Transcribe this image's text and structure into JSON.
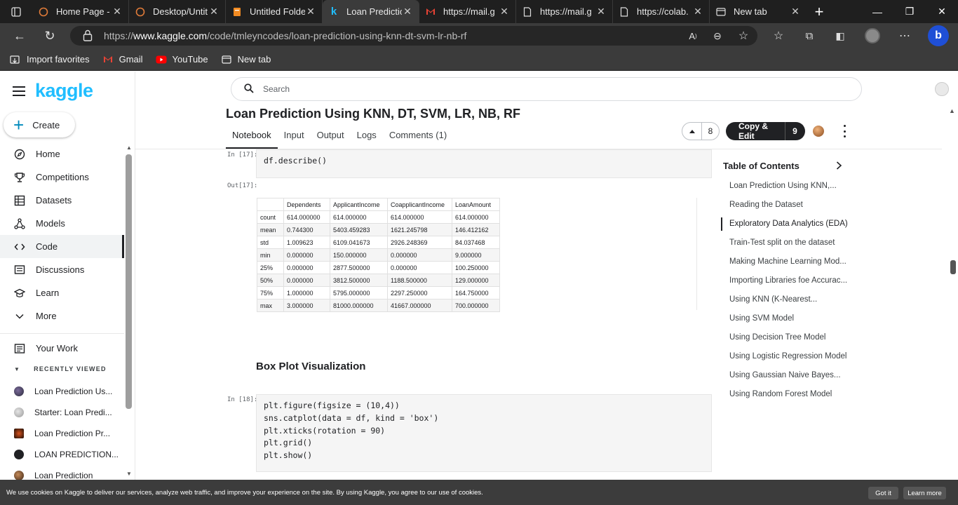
{
  "browser": {
    "tabs": [
      {
        "title": "Home Page -",
        "icon": "generic-orange-ring-icon",
        "active": false
      },
      {
        "title": "Desktop/Untit",
        "icon": "generic-orange-ring-icon",
        "active": false
      },
      {
        "title": "Untitled Folde",
        "icon": "document-orange-icon",
        "active": false
      },
      {
        "title": "Loan Predictio",
        "icon": "kaggle-k-icon",
        "active": true
      },
      {
        "title": "https://mail.g",
        "icon": "gmail-icon",
        "active": false
      },
      {
        "title": "https://mail.g",
        "icon": "page-icon",
        "active": false
      },
      {
        "title": "https://colab.",
        "icon": "page-icon",
        "active": false
      },
      {
        "title": "New tab",
        "icon": "newtab-icon",
        "active": false
      }
    ],
    "address": {
      "prefix": "https://",
      "host": "www.kaggle.com",
      "path": "/code/tmleyncodes/loan-prediction-using-knn-dt-svm-lr-nb-rf"
    },
    "favorites": [
      {
        "label": "Import favorites",
        "icon": "import-icon"
      },
      {
        "label": "Gmail",
        "icon": "gmail-icon"
      },
      {
        "label": "YouTube",
        "icon": "youtube-icon"
      },
      {
        "label": "New tab",
        "icon": "newtab-icon"
      }
    ]
  },
  "sidebar": {
    "logo": "kaggle",
    "create_label": "Create",
    "items": [
      {
        "label": "Home",
        "icon": "compass-icon"
      },
      {
        "label": "Competitions",
        "icon": "trophy-icon"
      },
      {
        "label": "Datasets",
        "icon": "table-icon"
      },
      {
        "label": "Models",
        "icon": "models-icon"
      },
      {
        "label": "Code",
        "icon": "code-icon",
        "active": true
      },
      {
        "label": "Discussions",
        "icon": "discussions-icon"
      },
      {
        "label": "Learn",
        "icon": "graduation-cap-icon"
      },
      {
        "label": "More",
        "icon": "chevron-down-icon"
      }
    ],
    "your_work": "Your Work",
    "recently_viewed_label": "RECENTLY VIEWED",
    "recent": [
      "Loan Prediction Us...",
      "Starter: Loan Predi...",
      "Loan Prediction Pr...",
      "LOAN PREDICTION...",
      "Loan Prediction"
    ]
  },
  "header": {
    "search_placeholder": "Search",
    "title": "Loan Prediction Using KNN, DT, SVM, LR, NB, RF",
    "tabs": [
      "Notebook",
      "Input",
      "Output",
      "Logs",
      "Comments (1)"
    ],
    "vote_count": "8",
    "copy_edit_label": "Copy & Edit",
    "copy_edit_count": "9"
  },
  "notebook": {
    "cell17_prompt": "In [17]:",
    "cell17_code": "df.describe()",
    "out17_prompt": "Out[17]:",
    "table": {
      "columns": [
        "",
        "Dependents",
        "ApplicantIncome",
        "CoapplicantIncome",
        "LoanAmount"
      ],
      "rows": [
        [
          "count",
          "614.000000",
          "614.000000",
          "614.000000",
          "614.000000"
        ],
        [
          "mean",
          "0.744300",
          "5403.459283",
          "1621.245798",
          "146.412162"
        ],
        [
          "std",
          "1.009623",
          "6109.041673",
          "2926.248369",
          "84.037468"
        ],
        [
          "min",
          "0.000000",
          "150.000000",
          "0.000000",
          "9.000000"
        ],
        [
          "25%",
          "0.000000",
          "2877.500000",
          "0.000000",
          "100.250000"
        ],
        [
          "50%",
          "0.000000",
          "3812.500000",
          "1188.500000",
          "129.000000"
        ],
        [
          "75%",
          "1.000000",
          "5795.000000",
          "2297.250000",
          "164.750000"
        ],
        [
          "max",
          "3.000000",
          "81000.000000",
          "41667.000000",
          "700.000000"
        ]
      ]
    },
    "markdown_heading": "Box Plot Visualization",
    "cell18_prompt": "In [18]:",
    "cell18_code": [
      "plt.figure(figsize = (10,4))",
      "sns.catplot(data = df, kind = 'box')",
      "plt.xticks(rotation = 90)",
      "plt.grid()",
      "plt.show()"
    ]
  },
  "toc": {
    "title": "Table of Contents",
    "items": [
      "Loan Prediction Using KNN,...",
      "Reading the Dataset",
      "Exploratory Data Analytics (EDA)",
      "Train-Test split on the dataset",
      "Making Machine Learning Mod...",
      "Importing Libraries foe Accurac...",
      "Using KNN (K-Nearest...",
      "Using SVM Model",
      "Using Decision Tree Model",
      "Using Logistic Regression Model",
      "Using Gaussian Naive Bayes...",
      "Using Random Forest Model"
    ],
    "active_index": 2
  },
  "cookie": {
    "text": "We use cookies on Kaggle to deliver our services, analyze web traffic, and improve your experience on the site. By using Kaggle, you agree to our use of cookies.",
    "got_it": "Got it",
    "learn_more": "Learn more"
  },
  "colors": {
    "kaggle_blue": "#20beff",
    "dark_chrome": "#1f1f1f",
    "string_red": "#a31515"
  }
}
